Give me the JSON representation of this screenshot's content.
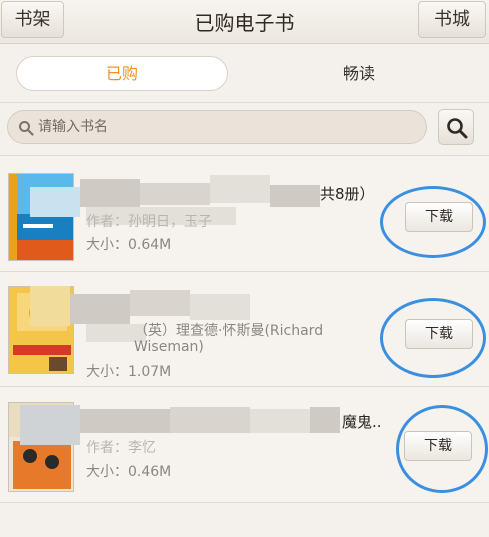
{
  "header": {
    "left_button": "书架",
    "title": "已购电子书",
    "right_button": "书城"
  },
  "tabs": {
    "active": "已购",
    "inactive": "畅读"
  },
  "search": {
    "placeholder": "请输入书名"
  },
  "books": [
    {
      "title_visible": "共8册）",
      "author_label": "作者：孙明日，玉子",
      "size_label": "大小：0.64M",
      "download_label": "下载"
    },
    {
      "author_line1": "（英）理查德·怀斯曼(Richard",
      "author_line2": "Wiseman)",
      "size_label": "大小：1.07M",
      "download_label": "下载"
    },
    {
      "title_visible": "魔鬼..",
      "author_label": "作者：李忆",
      "size_label": "大小：0.46M",
      "download_label": "下载"
    }
  ],
  "colors": {
    "accent_tab": "#f0941e",
    "annotation_circle": "#3b8fe0",
    "background": "#f4f1ec"
  }
}
